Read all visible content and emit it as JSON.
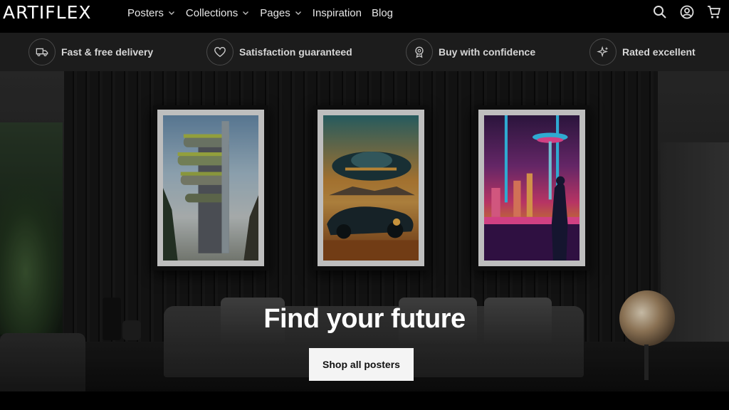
{
  "brand": {
    "logo": "ARTIFLEX"
  },
  "nav": {
    "items": [
      {
        "label": "Posters",
        "has_dropdown": true
      },
      {
        "label": "Collections",
        "has_dropdown": true
      },
      {
        "label": "Pages",
        "has_dropdown": true
      },
      {
        "label": "Inspiration",
        "has_dropdown": false
      },
      {
        "label": "Blog",
        "has_dropdown": false
      }
    ]
  },
  "header_icons": [
    "search-icon",
    "account-icon",
    "cart-icon"
  ],
  "trust_bar": {
    "items": [
      {
        "icon": "truck-icon",
        "label": "Fast & free delivery"
      },
      {
        "icon": "heart-icon",
        "label": "Satisfaction guaranteed"
      },
      {
        "icon": "badge-icon",
        "label": "Buy with confidence"
      },
      {
        "icon": "sparkle-icon",
        "label": "Rated excellent"
      }
    ]
  },
  "hero": {
    "title": "Find your future",
    "button_label": "Shop all posters"
  },
  "colors": {
    "header_bg": "#000000",
    "trust_bg": "#1c1c1c",
    "button_bg": "#f4f4f4",
    "text": "#ffffff"
  }
}
